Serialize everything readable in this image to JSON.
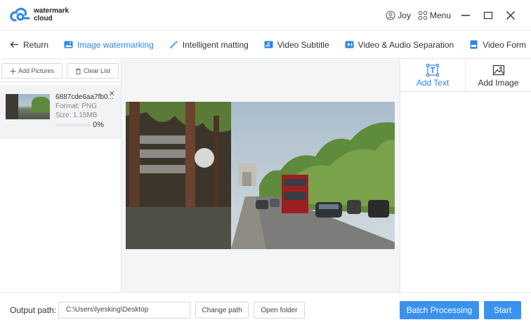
{
  "app": {
    "logo_line1": "watermark",
    "logo_line2": "cloud",
    "user": "Joy",
    "menu": "Menu"
  },
  "tabs": [
    {
      "label": "Return",
      "icon": "arrow-left-icon"
    },
    {
      "label": "Image watermarking",
      "icon": "image-icon",
      "active": true
    },
    {
      "label": "Intelligent matting",
      "icon": "magic-wand-icon"
    },
    {
      "label": "Video Subtitle",
      "icon": "video-subtitle-icon"
    },
    {
      "label": "Video & Audio Separation",
      "icon": "video-audio-icon"
    },
    {
      "label": "Video Form",
      "icon": "video-format-icon"
    }
  ],
  "left": {
    "add_label": "Add Pictures",
    "clear_label": "Clear List",
    "file": {
      "name": "6887cde6aa7fb0...",
      "format": "Format:  PNG",
      "size": "Size:  1.15MB",
      "progress": 0,
      "progress_text": "0%"
    }
  },
  "right": {
    "add_text": "Add Text",
    "add_image": "Add Image"
  },
  "bottom": {
    "output_label": "Output path:",
    "path_value": "C:\\Users\\lyesking\\Desktop",
    "change_path": "Change path",
    "open_folder": "Open folder",
    "batch": "Batch Processing",
    "start": "Start"
  },
  "colors": {
    "accent": "#2d86ea",
    "primary_button": "#3a92f0"
  }
}
